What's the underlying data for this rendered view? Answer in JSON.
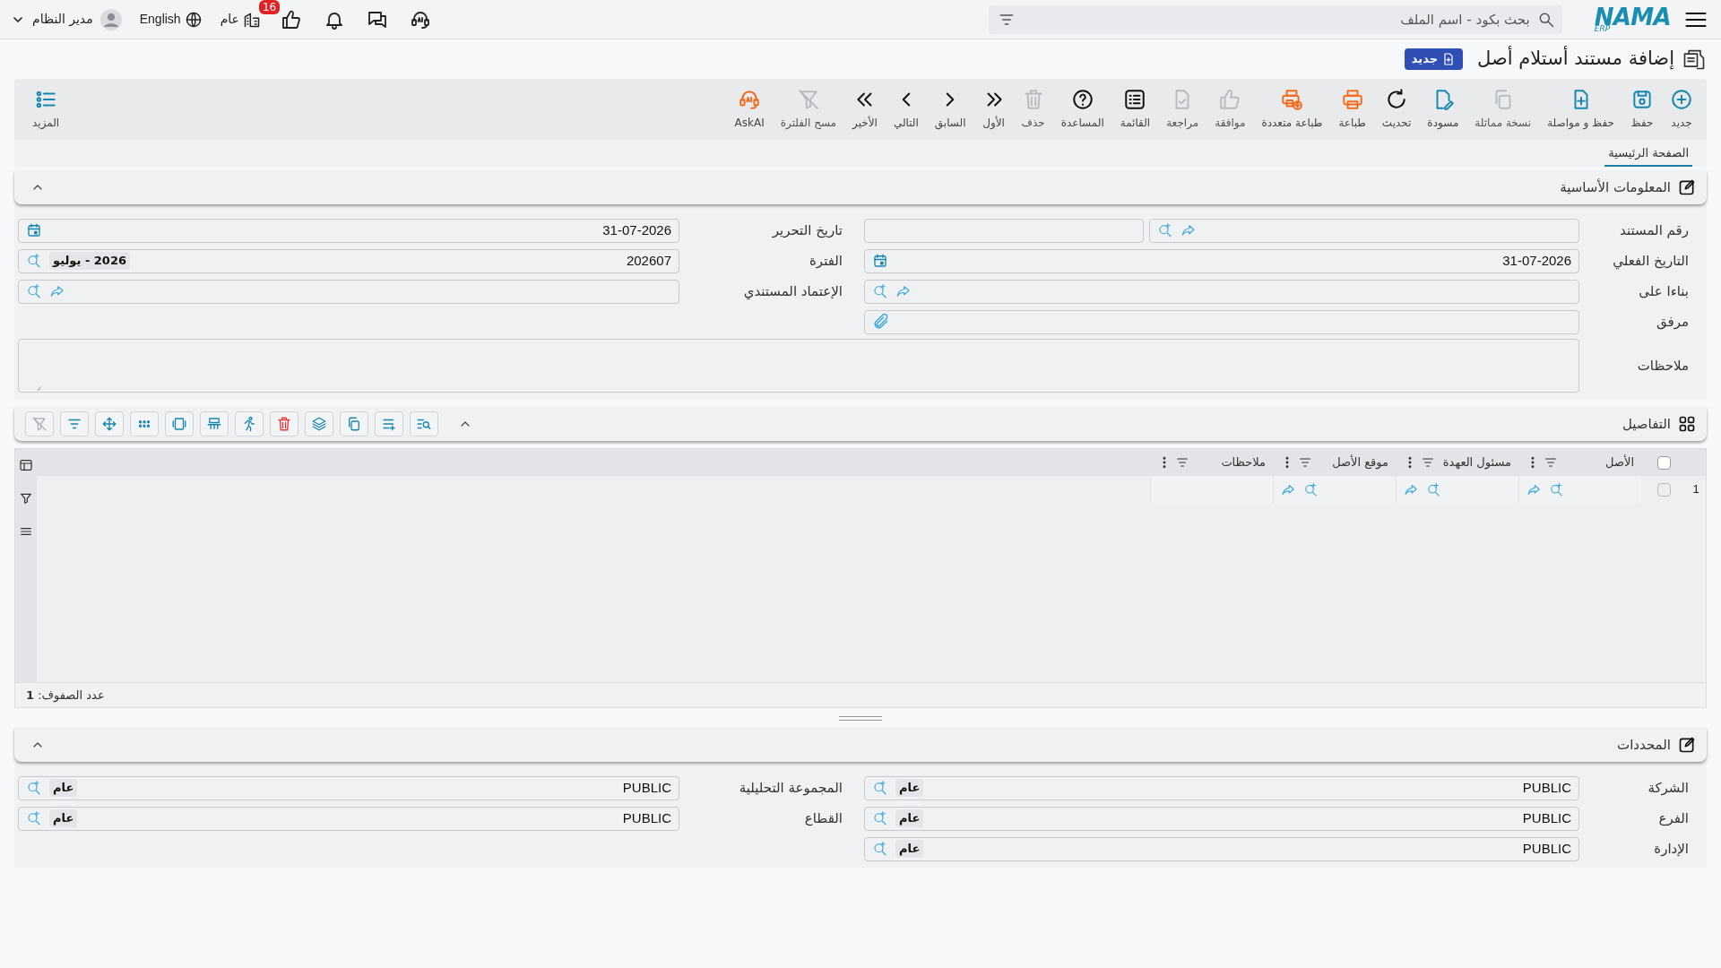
{
  "top_bar": {
    "logo": "NAMA",
    "logo_sub": "ERP",
    "search": {
      "placeholder": "بحث بكود - اسم الملف"
    },
    "likes_badge": "16",
    "company": "عام",
    "language": "English",
    "user": "مدير النظام"
  },
  "page": {
    "title": "إضافة مستند أستلام أصل",
    "status_badge": "جديد"
  },
  "toolbar": [
    {
      "label": "جديد",
      "kind": "edit",
      "disabled": false
    },
    {
      "label": "حفظ",
      "kind": "edit",
      "disabled": false
    },
    {
      "label": "حفظ و مواصلة",
      "kind": "edit",
      "disabled": false
    },
    {
      "label": "نسخة مماثلة",
      "kind": "edit",
      "disabled": true
    },
    {
      "label": "مسودة",
      "kind": "edit",
      "disabled": false
    },
    {
      "label": "تحديث",
      "kind": "nav",
      "disabled": false
    },
    {
      "label": "طباعة",
      "kind": "print",
      "disabled": false
    },
    {
      "label": "طباعة متعددة",
      "kind": "print",
      "disabled": false
    },
    {
      "label": "موافقة",
      "kind": "nav",
      "disabled": true
    },
    {
      "label": "مراجعة",
      "kind": "nav",
      "disabled": true
    },
    {
      "label": "القائمة",
      "kind": "nav",
      "disabled": false
    },
    {
      "label": "المساعدة",
      "kind": "nav",
      "disabled": false
    },
    {
      "label": "حذف",
      "kind": "nav",
      "disabled": true
    },
    {
      "label": "الأول",
      "kind": "nav",
      "disabled": false
    },
    {
      "label": "السابق",
      "kind": "nav",
      "disabled": false
    },
    {
      "label": "التالي",
      "kind": "nav",
      "disabled": false
    },
    {
      "label": "الأخير",
      "kind": "nav",
      "disabled": false
    },
    {
      "label": "مسح الفلترة",
      "kind": "nav",
      "disabled": true
    },
    {
      "label": "AskAI",
      "kind": "print",
      "disabled": false
    }
  ],
  "more_button": "المزيد",
  "tabs": [
    {
      "label": "الصفحة الرئيسية",
      "selected": true
    }
  ],
  "basic_info": {
    "title": "المعلومات الأساسية",
    "expanded": true,
    "right_column": [
      {
        "label": "رقم المستند",
        "kind": "split"
      },
      {
        "label": "التاريخ الفعلي",
        "kind": "date",
        "value": "31-07-2026"
      },
      {
        "label": "بناءا على",
        "kind": "lookup"
      },
      {
        "label": "مرفق",
        "kind": "attachment"
      }
    ],
    "left_column": [
      {
        "label": "تاريخ التحرير",
        "kind": "date",
        "value": "31-07-2026"
      },
      {
        "label": "الفترة",
        "kind": "search",
        "value": "202607",
        "tag": "2026 - يوليو"
      },
      {
        "label": "الإعتماد المستندي",
        "kind": "lookup"
      }
    ],
    "notes_label": "ملاحظات"
  },
  "details": {
    "title": "التفاصيل",
    "expanded": true,
    "tools": [
      {
        "kind": "plain",
        "disabled": false
      },
      {
        "kind": "plain",
        "disabled": false
      },
      {
        "kind": "plain",
        "disabled": false
      },
      {
        "kind": "plain",
        "disabled": false
      },
      {
        "kind": "danger",
        "disabled": false
      },
      {
        "kind": "plain",
        "disabled": false
      },
      {
        "kind": "plain",
        "disabled": false
      },
      {
        "kind": "plain",
        "disabled": false
      },
      {
        "kind": "plain",
        "disabled": false
      },
      {
        "kind": "plain",
        "disabled": false
      },
      {
        "kind": "plain",
        "disabled": false
      },
      {
        "kind": "plain",
        "disabled": true
      }
    ],
    "select_all_checked": false,
    "columns": [
      {
        "label": "الأصل",
        "kind": "lookup"
      },
      {
        "label": "مسئول العهدة",
        "kind": "lookup"
      },
      {
        "label": "موقع الأصل",
        "kind": "lookup"
      },
      {
        "label": "ملاحظات",
        "kind": "text"
      }
    ],
    "rows": [
      {
        "number": "1",
        "checked": false
      }
    ],
    "row_count": "عدد الصفوف: **1**"
  },
  "determinants": {
    "title": "المحددات",
    "expanded": true,
    "right_column": [
      {
        "label": "الشركة",
        "value": "PUBLIC",
        "tag": "عام"
      },
      {
        "label": "الفرع",
        "value": "PUBLIC",
        "tag": "عام"
      },
      {
        "label": "الإدارة",
        "value": "PUBLIC",
        "tag": "عام"
      }
    ],
    "left_column": [
      {
        "label": "المجموعة التحليلية",
        "value": "PUBLIC",
        "tag": "عام"
      },
      {
        "label": "القطاع",
        "value": "PUBLIC",
        "tag": "عام"
      }
    ]
  }
}
